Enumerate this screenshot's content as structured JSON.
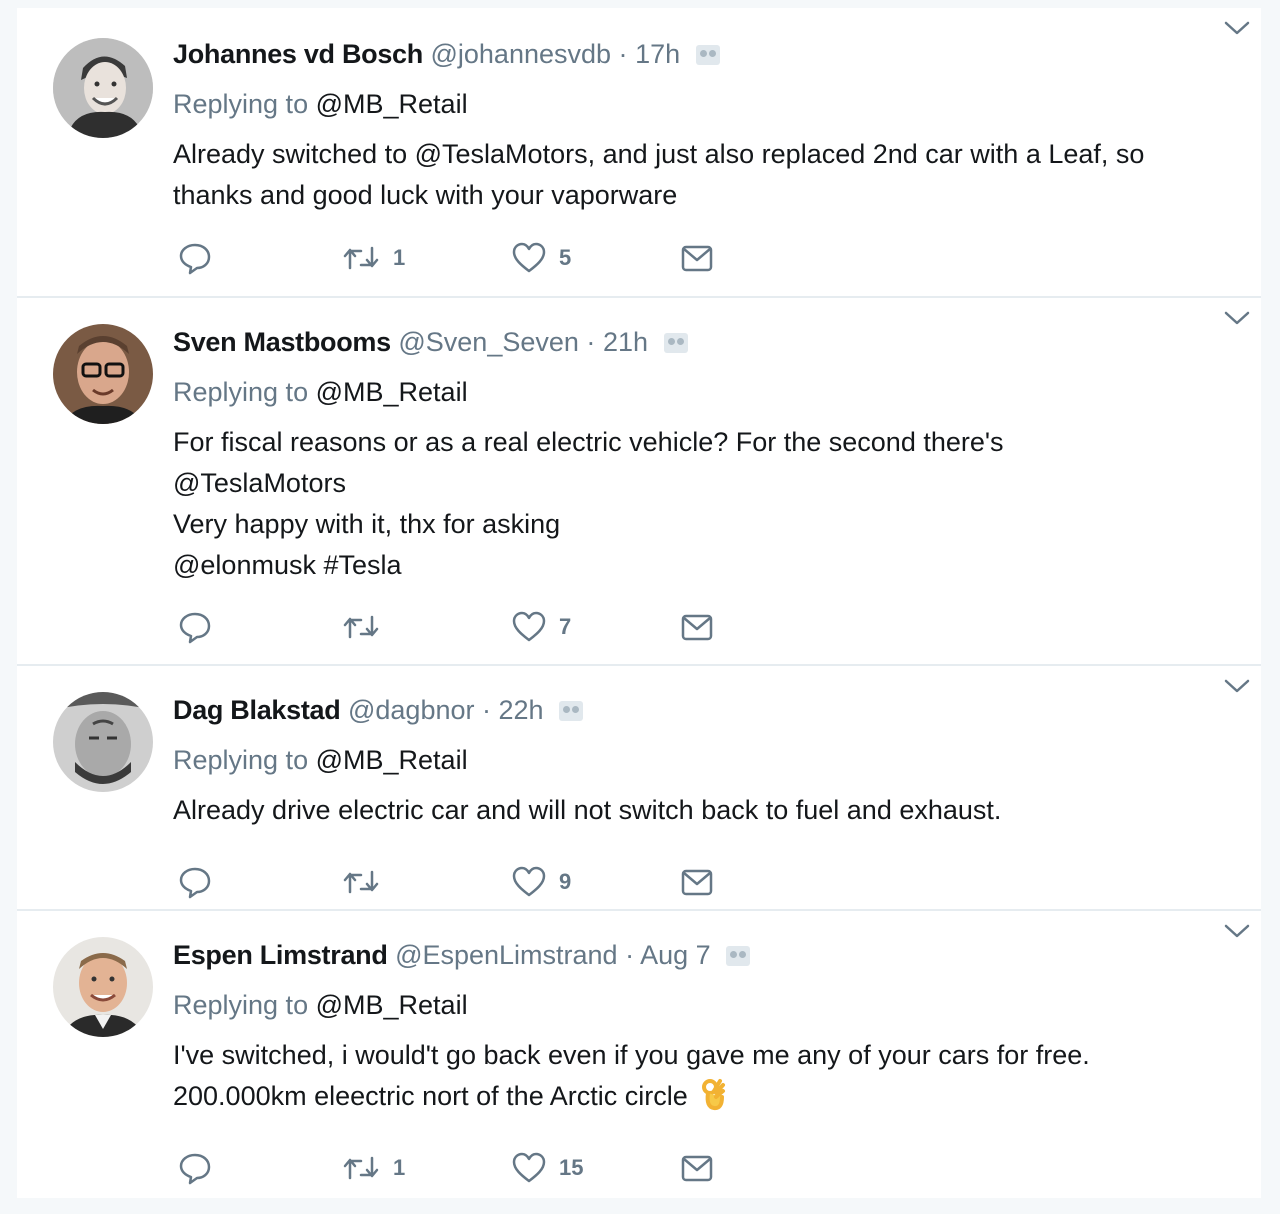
{
  "tweets": [
    {
      "name": "Johannes vd Bosch",
      "handle": "@johannesvdb",
      "dot": "·",
      "time": "17h",
      "reply_prefix": "Replying to",
      "reply_to": "@MB_Retail",
      "text_lines": [
        "Already switched to @TeslaMotors, and just also replaced 2nd car with a Leaf, so",
        "thanks and good luck with your vaporware"
      ],
      "retweets": "1",
      "likes": "5"
    },
    {
      "name": "Sven Mastbooms",
      "handle": "@Sven_Seven",
      "dot": "·",
      "time": "21h",
      "reply_prefix": "Replying to",
      "reply_to": "@MB_Retail",
      "text_lines": [
        "For fiscal reasons or as a real electric vehicle? For the second there's",
        "@TeslaMotors",
        "Very happy with it, thx for asking",
        "@elonmusk #Tesla"
      ],
      "retweets": "",
      "likes": "7"
    },
    {
      "name": "Dag Blakstad",
      "handle": "@dagbnor",
      "dot": "·",
      "time": "22h",
      "reply_prefix": "Replying to",
      "reply_to": "@MB_Retail",
      "text_lines": [
        "Already drive electric car and will not switch back to fuel and exhaust."
      ],
      "retweets": "",
      "likes": "9"
    },
    {
      "name": "Espen Limstrand",
      "handle": "@EspenLimstrand",
      "dot": "·",
      "time": "Aug 7",
      "reply_prefix": "Replying to",
      "reply_to": "@MB_Retail",
      "text_lines": [
        "I've switched, i would't go back even if you gave me any of your cars for free.",
        "200.000km eleectric nort of the Arctic circle"
      ],
      "emoji": "ok-hand",
      "retweets": "1",
      "likes": "15"
    }
  ],
  "icons": {
    "reply": "reply-icon",
    "retweet": "retweet-icon",
    "like": "heart-icon",
    "dm": "envelope-icon",
    "caret": "chevron-down-icon",
    "translate": "translate-icon"
  },
  "colors": {
    "icon_gray": "#657786",
    "divider": "#e6ecf0",
    "text": "#14171a",
    "background": "#f5f8fa"
  }
}
